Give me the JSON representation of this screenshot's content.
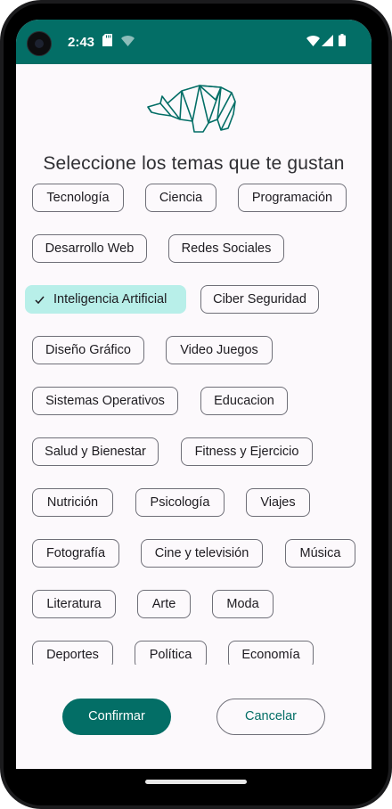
{
  "status_bar": {
    "time": "2:43"
  },
  "header": {
    "title": "Seleccione los temas que te gustan"
  },
  "topics": [
    {
      "label": "Tecnología",
      "selected": false
    },
    {
      "label": "Ciencia",
      "selected": false
    },
    {
      "label": "Programación",
      "selected": false
    },
    {
      "label": "Desarrollo Web",
      "selected": false
    },
    {
      "label": "Redes Sociales",
      "selected": false
    },
    {
      "label": "Inteligencia Artificial",
      "selected": true
    },
    {
      "label": "Ciber Seguridad",
      "selected": false
    },
    {
      "label": "Diseño Gráfico",
      "selected": false
    },
    {
      "label": "Video Juegos",
      "selected": false
    },
    {
      "label": "Sistemas Operativos",
      "selected": false
    },
    {
      "label": "Educacion",
      "selected": false
    },
    {
      "label": "Salud y Bienestar",
      "selected": false
    },
    {
      "label": "Fitness y Ejercicio",
      "selected": false
    },
    {
      "label": "Nutrición",
      "selected": false
    },
    {
      "label": "Psicología",
      "selected": false
    },
    {
      "label": "Viajes",
      "selected": false
    },
    {
      "label": "Fotografía",
      "selected": false
    },
    {
      "label": "Cine y televisión",
      "selected": false
    },
    {
      "label": "Música",
      "selected": false
    },
    {
      "label": "Literatura",
      "selected": false
    },
    {
      "label": "Arte",
      "selected": false
    },
    {
      "label": "Moda",
      "selected": false
    },
    {
      "label": "Deportes",
      "selected": false
    },
    {
      "label": "Política",
      "selected": false
    },
    {
      "label": "Economía",
      "selected": false
    }
  ],
  "actions": {
    "confirm_label": "Confirmar",
    "cancel_label": "Cancelar"
  },
  "colors": {
    "primary": "#036e66",
    "selected_chip": "#b8efe9",
    "background": "#fcf9fc"
  },
  "icons": [
    "camera-icon",
    "sd-card-icon",
    "wifi-icon",
    "signal-icon",
    "battery-icon",
    "rhino-logo-icon",
    "check-icon"
  ]
}
